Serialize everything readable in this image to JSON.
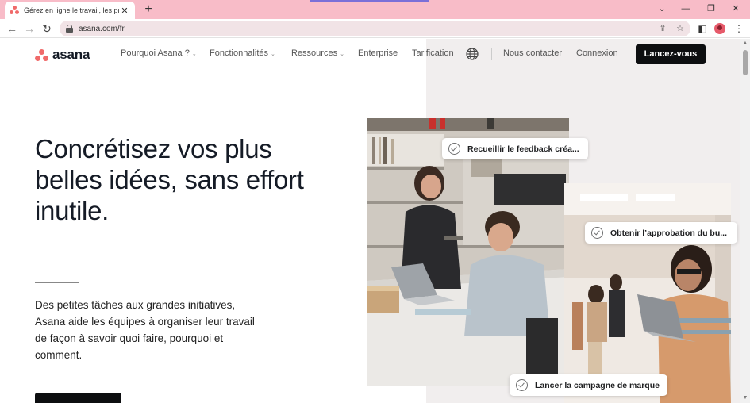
{
  "browser": {
    "tab_title": "Gérez en ligne le travail, les projets",
    "tab_close": "✕",
    "new_tab": "+",
    "url": "asana.com/fr",
    "window_controls": {
      "minimize": "⌄",
      "restore": "—",
      "maximize": "❐",
      "close": "✕"
    }
  },
  "nav": {
    "brand": "asana",
    "items": [
      {
        "label": "Pourquoi Asana ?",
        "dropdown": true
      },
      {
        "label": "Fonctionnalités",
        "dropdown": true
      },
      {
        "label": "Ressources",
        "dropdown": true
      },
      {
        "label": "Enterprise",
        "dropdown": false
      },
      {
        "label": "Tarification",
        "dropdown": false
      }
    ],
    "contact": "Nous contacter",
    "login": "Connexion",
    "cta": "Lancez-vous"
  },
  "hero": {
    "headline": "Concrétisez vos plus belles idées, sans effort inutile.",
    "lead": "Des petites tâches aux grandes initiatives, Asana aide les équipes à organiser leur travail de façon à savoir quoi faire, pourquoi et comment."
  },
  "tasks": [
    {
      "label": "Recueillir le feedback créa..."
    },
    {
      "label": "Obtenir l’approbation du bu..."
    },
    {
      "label": "Lancer la campagne de marque"
    }
  ],
  "colors": {
    "brand_coral": "#f06a6a",
    "cta_black": "#0d0e10",
    "tab_strip": "#f8bcc8",
    "right_panel": "#f1eeee"
  }
}
